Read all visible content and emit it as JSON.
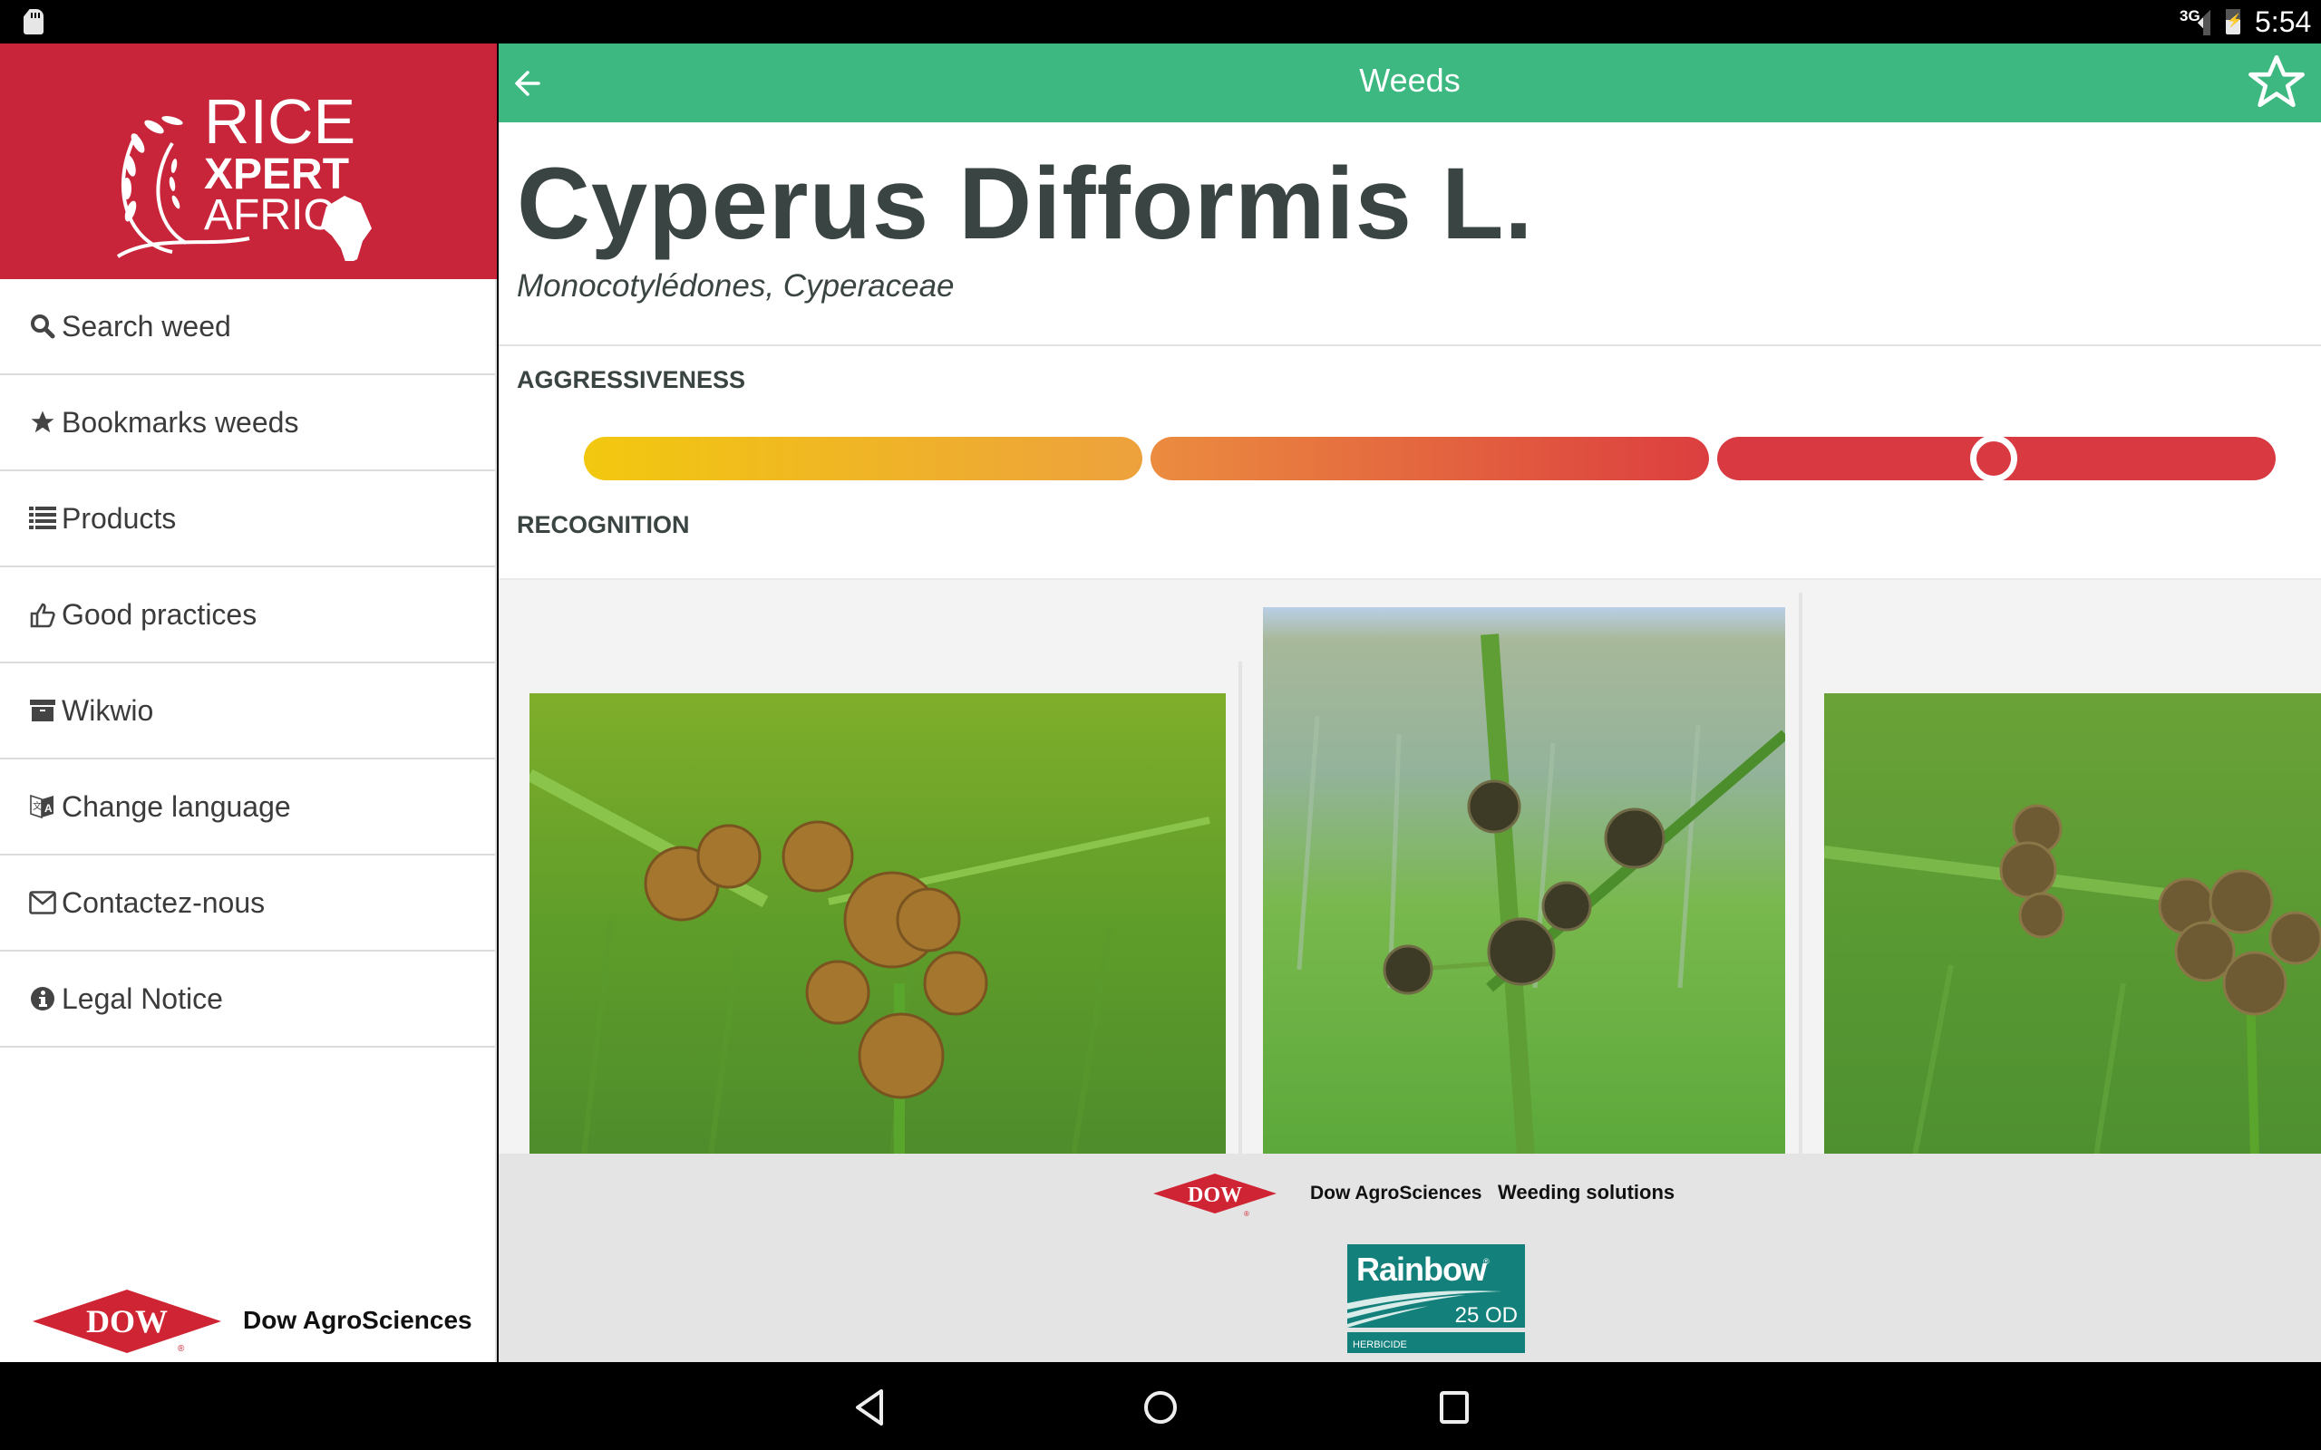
{
  "status_bar": {
    "network": "3G",
    "time": "5:54",
    "icons": [
      "sd-card-icon",
      "signal-icon",
      "battery-charging-icon"
    ]
  },
  "brand": {
    "line1": "RICE",
    "line2": "XPERT",
    "line3": "AFRICA",
    "color": "#c8253a"
  },
  "sidebar": {
    "items": [
      {
        "label": "Search weed",
        "icon": "search-icon"
      },
      {
        "label": "Bookmarks weeds",
        "icon": "star-icon"
      },
      {
        "label": "Products",
        "icon": "list-icon"
      },
      {
        "label": "Good practices",
        "icon": "thumbs-up-icon"
      },
      {
        "label": "Wikwio",
        "icon": "archive-icon"
      },
      {
        "label": "Change language",
        "icon": "translate-icon"
      },
      {
        "label": "Contactez-nous",
        "icon": "envelope-icon"
      },
      {
        "label": "Legal Notice",
        "icon": "info-icon"
      }
    ],
    "sponsor": {
      "mark": "DOW",
      "name": "Dow AgroSciences"
    }
  },
  "app_bar": {
    "title": "Weeds",
    "back_icon": "arrow-left-icon",
    "bookmark_icon": "star-outline-icon",
    "color": "#3db880"
  },
  "weed": {
    "name": "Cyperus Difformis L.",
    "classification": "Monocotylédones, Cyperaceae"
  },
  "aggressiveness": {
    "label": "AGGRESSIVENESS",
    "levels": 3,
    "value_fraction": 0.495,
    "level_colors": [
      [
        "#f2c80f",
        "#eda13d"
      ],
      [
        "#eb8c3f",
        "#dc3e3f"
      ],
      [
        "#d93a42",
        "#d93a42"
      ]
    ]
  },
  "recognition": {
    "label": "RECOGNITION",
    "images": [
      {
        "alt": "Cyperus difformis flower heads, brown clusters on green background"
      },
      {
        "alt": "Cyperus difformis dark spikelets in tall grass"
      },
      {
        "alt": "Cyperus difformis stem with flower clusters in rice field"
      }
    ]
  },
  "footer": {
    "sponsor_mark": "DOW",
    "sponsor_name": "Dow AgroSciences",
    "tagline": "Weeding solutions",
    "product": {
      "name": "Rainbow",
      "registered": "®",
      "formulation": "25 OD",
      "category": "HERBICIDE",
      "color": "#13807b"
    }
  },
  "nav_bar": {
    "buttons": [
      "back",
      "home",
      "recents"
    ]
  }
}
